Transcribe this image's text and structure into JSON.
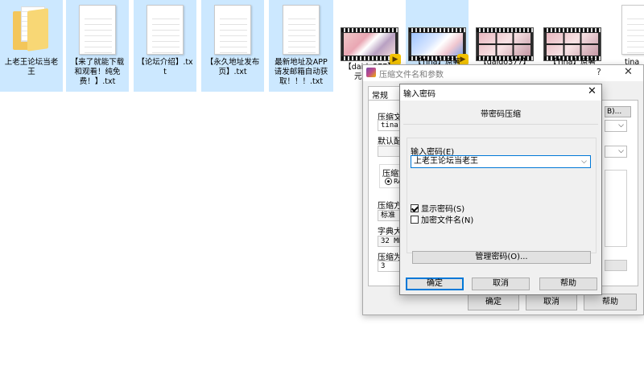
{
  "desktop": {
    "files": [
      {
        "type": "folder",
        "label": "上老王论坛当老王",
        "selected": true
      },
      {
        "type": "txt",
        "label": "【来了就能下载和观看！纯免费！】.txt",
        "selected": true
      },
      {
        "type": "txt",
        "label": "【论坛介绍】.txt",
        "selected": true
      },
      {
        "type": "txt",
        "label": "【永久地址发布页】.txt",
        "selected": true
      },
      {
        "type": "txt",
        "label": "最新地址及APP请发邮箱自动获取！！！.txt",
        "selected": true
      },
      {
        "type": "video",
        "label": "【daido377】元月最新",
        "selected": false
      },
      {
        "type": "video",
        "label": "【Tina】原著",
        "selected": true
      },
      {
        "type": "video",
        "label": "【daido377】元",
        "selected": false
      },
      {
        "type": "video",
        "label": "【Tina】原著",
        "selected": false
      },
      {
        "type": "partial",
        "label": "tina",
        "selected": false
      }
    ]
  },
  "archive_dialog": {
    "title": "压缩文件名和参数",
    "help_glyph": "?",
    "close_glyph": "✕",
    "tab_general": "常规",
    "archive_name_label": "压缩文件名",
    "archive_name_value": "tina.r",
    "browse_label": "B)...",
    "default_profile_label": "默认配置",
    "format_label": "压缩文件格式",
    "format_rar": "RAR",
    "method_label": "压缩方式",
    "method_value": "标准",
    "dict_label": "字典大小",
    "dict_value": "32 MB",
    "split_label": "压缩为分卷",
    "split_value": "3",
    "combo_caret": "⌵",
    "ok": "确定",
    "cancel": "取消",
    "help": "帮助"
  },
  "password_dialog": {
    "title": "输入密码",
    "close_glyph": "✕",
    "heading": "带密码压缩",
    "enter_label": "输入密码(E)",
    "password_value": "上老王论坛当老王",
    "caret": "⌵",
    "show_password": "显示密码(S)",
    "show_password_checked": true,
    "encrypt_names": "加密文件名(N)",
    "encrypt_names_checked": false,
    "manage": "管理密码(O)...",
    "ok": "确定",
    "cancel": "取消",
    "help": "帮助"
  },
  "colors": {
    "selection": "#cce8ff",
    "focus": "#0078d7",
    "dialog_bg": "#f0f0f0"
  }
}
